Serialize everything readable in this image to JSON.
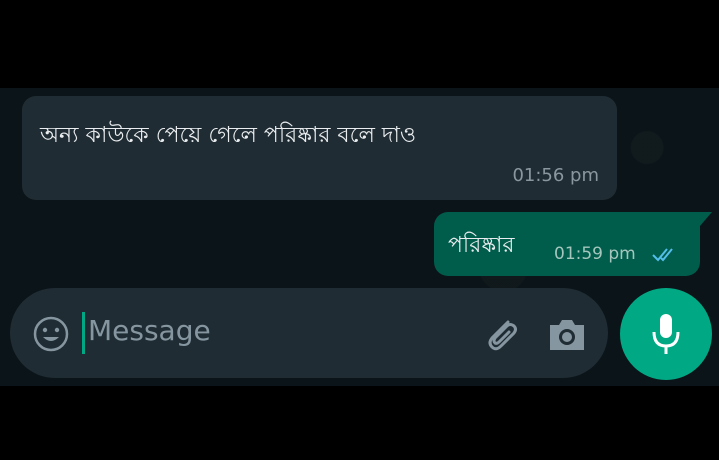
{
  "conversation": {
    "messages": [
      {
        "direction": "incoming",
        "text": "অন্য কাউকে পেয়ে গেলে পরিষ্কার বলে দাও",
        "time": "01:56 pm"
      },
      {
        "direction": "outgoing",
        "text": "পরিষ্কার",
        "time": "01:59 pm",
        "status": "sent"
      }
    ]
  },
  "composer": {
    "placeholder": "Message",
    "icons": {
      "emoji": "emoji-icon",
      "attach": "paperclip-icon",
      "camera": "camera-icon",
      "mic": "microphone-icon"
    }
  },
  "colors": {
    "background": "#0b1418",
    "incoming_bubble": "#202c33",
    "outgoing_bubble": "#005c4b",
    "accent": "#00a884",
    "tick": "#53bdeb"
  }
}
